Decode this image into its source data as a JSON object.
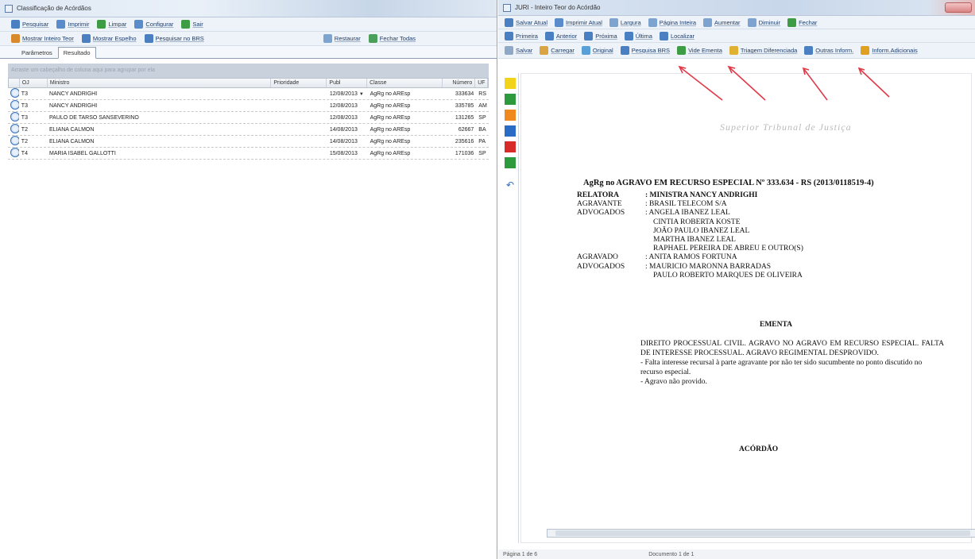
{
  "left_window": {
    "title": "Classificação de Acórdãos",
    "toolbar1": [
      {
        "label": "Pesquisar",
        "icon": "search-icon",
        "color": "#4a7fc1"
      },
      {
        "label": "Imprimir",
        "icon": "print-icon",
        "color": "#5a8ccc"
      },
      {
        "label": "Limpar",
        "icon": "clear-icon",
        "color": "#3d9c44"
      },
      {
        "label": "Configurar",
        "icon": "config-icon",
        "color": "#5a8ccc"
      },
      {
        "label": "Sair",
        "icon": "exit-icon",
        "color": "#3d9c44"
      }
    ],
    "toolbar2_left": [
      {
        "label": "Mostrar Inteiro Teor",
        "icon": "document-icon",
        "color": "#d8892b"
      },
      {
        "label": "Mostrar Espelho",
        "icon": "mirror-icon",
        "color": "#4a7fc1"
      },
      {
        "label": "Pesquisar no BRS",
        "icon": "search-brs-icon",
        "color": "#4a7fc1"
      }
    ],
    "toolbar2_right": [
      {
        "label": "Restaurar",
        "icon": "restore-icon",
        "color": "#7da4d1"
      },
      {
        "label": "Fechar Todas",
        "icon": "close-all-icon",
        "color": "#4aa05a"
      }
    ],
    "tabs": [
      "Parâmetros",
      "Resultado"
    ],
    "group_hint": "Arraste um cabeçalho de coluna aqui para agrupar por ela",
    "columns": [
      "OJ",
      "Ministro",
      "Prioridade",
      "Publ",
      "Classe",
      "Número",
      "UF"
    ],
    "rows": [
      {
        "oj": "T3",
        "ministro": "NANCY ANDRIGHI",
        "publ": "12/08/2013",
        "classe": "AgRg no AREsp",
        "numero": "333634",
        "uf": "RS"
      },
      {
        "oj": "T3",
        "ministro": "NANCY ANDRIGHI",
        "publ": "12/08/2013",
        "classe": "AgRg no AREsp",
        "numero": "335785",
        "uf": "AM"
      },
      {
        "oj": "T3",
        "ministro": "PAULO DE TARSO SANSEVERINO",
        "publ": "12/08/2013",
        "classe": "AgRg no AREsp",
        "numero": "131265",
        "uf": "SP"
      },
      {
        "oj": "T2",
        "ministro": "ELIANA CALMON",
        "publ": "14/08/2013",
        "classe": "AgRg no AREsp",
        "numero": "62667",
        "uf": "BA"
      },
      {
        "oj": "T2",
        "ministro": "ELIANA CALMON",
        "publ": "14/08/2013",
        "classe": "AgRg no AREsp",
        "numero": "235616",
        "uf": "PA"
      },
      {
        "oj": "T4",
        "ministro": "MARIA ISABEL GALLOTTI",
        "publ": "15/08/2013",
        "classe": "AgRg no AREsp",
        "numero": "171036",
        "uf": "SP"
      }
    ]
  },
  "right_window": {
    "title": "JURI - Inteiro Teor do Acórdão",
    "toolbar1": [
      "Salvar Atual",
      "Imprimir Atual",
      "Largura",
      "Página Inteira",
      "Aumentar",
      "Diminuir",
      "Fechar"
    ],
    "toolbar2": [
      "Primeira",
      "Anterior",
      "Próxima",
      "Última",
      "Localizar"
    ],
    "toolbar3": [
      "Salvar",
      "Carregar",
      "Original",
      "Pesquisa BRS",
      "Vide Ementa",
      "Triagem Diferenciada",
      "Outras Inform.",
      "Inform.Adicionais"
    ],
    "strip_colors": [
      "#f3d21a",
      "#2e9a3e",
      "#f08a1e",
      "#2a6bc6",
      "#d92a2a",
      "#2e9a3e"
    ],
    "document": {
      "court": "Superior Tribunal de Justiça",
      "heading": "AgRg no AGRAVO EM RECURSO ESPECIAL Nº 333.634 - RS (2013/0118519-4)",
      "parties": [
        {
          "label": "RELATORA",
          "value": ": MINISTRA NANCY ANDRIGHI",
          "bold": true
        },
        {
          "label": "AGRAVANTE",
          "value": ": BRASIL TELECOM S/A"
        },
        {
          "label": "ADVOGADOS",
          "value": ": ANGELA IBANEZ LEAL"
        },
        {
          "label": "",
          "value": "CINTIA ROBERTA KOSTE"
        },
        {
          "label": "",
          "value": "JOÃO PAULO IBANEZ LEAL"
        },
        {
          "label": "",
          "value": "MARTHA IBANEZ LEAL"
        },
        {
          "label": "",
          "value": "RAPHAEL PEREIRA DE ABREU E OUTRO(S)"
        },
        {
          "label": "AGRAVADO",
          "value": ": ANITA RAMOS FORTUNA"
        },
        {
          "label": "ADVOGADOS",
          "value": ": MAURICIO MARONNA BARRADAS"
        },
        {
          "label": "",
          "value": "PAULO ROBERTO MARQUES DE OLIVEIRA"
        }
      ],
      "ementa_title": "EMENTA",
      "ementa_lines": [
        "DIREITO PROCESSUAL CIVIL. AGRAVO NO AGRAVO EM RECURSO ESPECIAL. FALTA DE INTERESSE PROCESSUAL. AGRAVO REGIMENTAL DESPROVIDO.",
        "- Falta interesse recursal à parte agravante por não ter sido sucumbente no ponto discutido no recurso especial.",
        "- Agravo não provido."
      ],
      "acordao": "ACÓRDÃO"
    },
    "status": [
      "Página 1 de 6",
      "Documento 1 de 1"
    ]
  }
}
